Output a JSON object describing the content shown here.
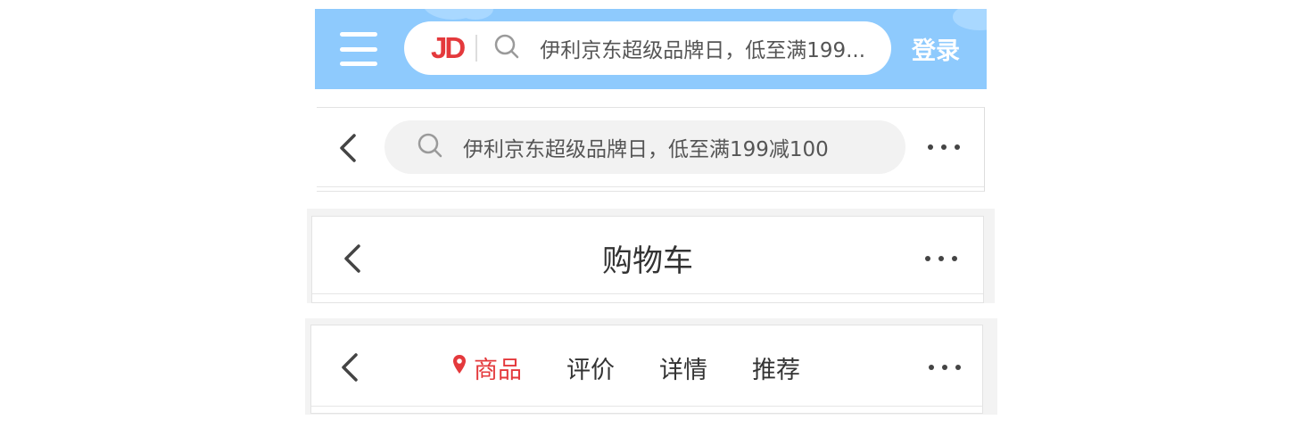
{
  "home_header": {
    "logo_text": "JD",
    "search_placeholder": "伊利京东超级品牌日，低至满199...",
    "login_label": "登录",
    "background_color": "#8ecafd",
    "icons": [
      "menu-icon",
      "search-icon"
    ]
  },
  "search_header": {
    "search_placeholder": "伊利京东超级品牌日，低至满199减100",
    "icons": [
      "back-icon",
      "search-icon",
      "more-icon"
    ]
  },
  "cart_header": {
    "title": "购物车",
    "icons": [
      "back-icon",
      "more-icon"
    ]
  },
  "product_header": {
    "tabs": [
      {
        "label": "商品",
        "active": true
      },
      {
        "label": "评价",
        "active": false
      },
      {
        "label": "详情",
        "active": false
      },
      {
        "label": "推荐",
        "active": false
      }
    ],
    "accent_color": "#e4393c",
    "icons": [
      "back-icon",
      "location-pin-icon",
      "more-icon"
    ]
  }
}
